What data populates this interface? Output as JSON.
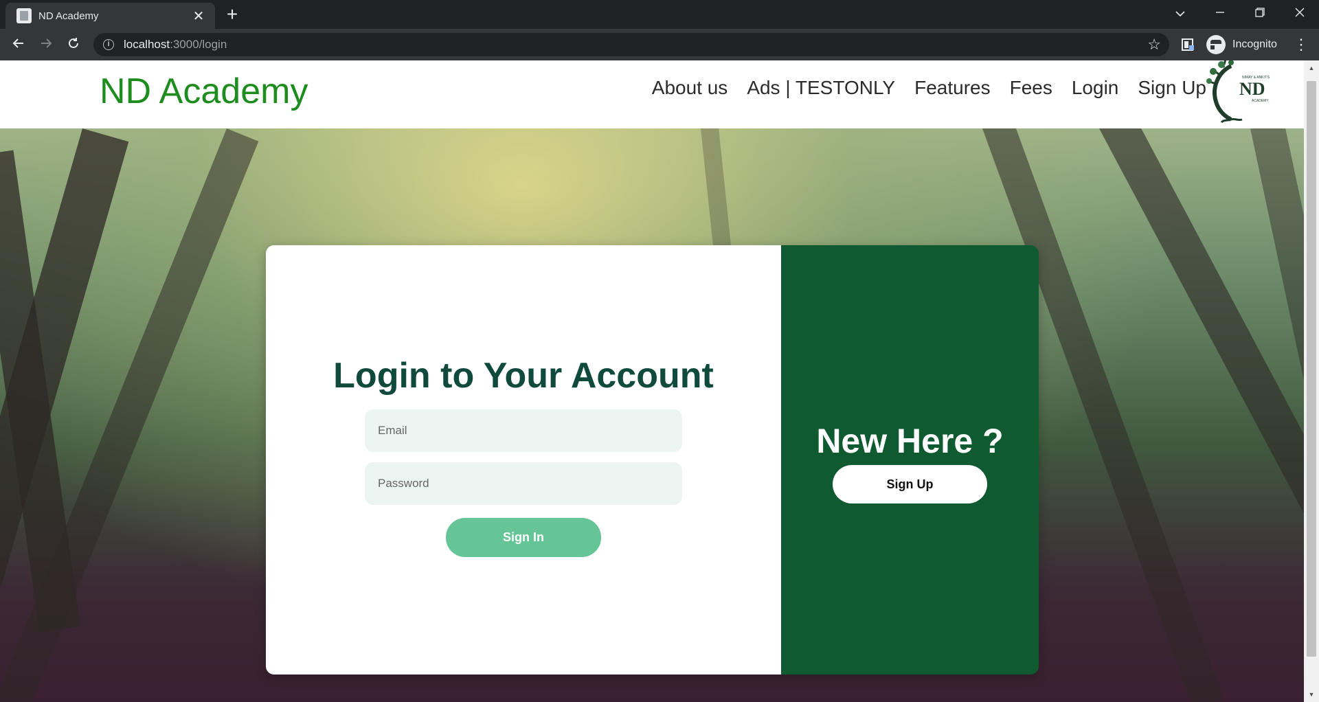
{
  "browser": {
    "tab_title": "ND Academy",
    "tab_close_glyph": "✕",
    "new_tab_glyph": "+",
    "url_host": "localhost",
    "url_path": ":3000/login",
    "profile_label": "Incognito",
    "icons": [
      "back-arrow-icon",
      "forward-arrow-icon",
      "reload-icon",
      "info-icon",
      "star-icon",
      "extension-icon",
      "incognito-icon",
      "kebab-menu-icon",
      "tab-search-icon",
      "minimize-icon",
      "restore-icon",
      "close-window-icon"
    ]
  },
  "site": {
    "title": "ND Academy",
    "nav": [
      "About us",
      "Ads | TESTONLY",
      "Features",
      "Fees",
      "Login",
      "Sign Up"
    ],
    "logo_text": "ND",
    "logo_small_text": "NIMAY & ANKIT'S",
    "logo_sub_text": "ACADEMY",
    "title_color": "#1e8c1e"
  },
  "login": {
    "title": "Login to Your Account",
    "email_placeholder": "Email",
    "password_placeholder": "Password",
    "signin_label": "Sign In"
  },
  "signup_panel": {
    "heading": "New Here ?",
    "signup_label": "Sign Up",
    "panel_color": "#0f5a30"
  }
}
